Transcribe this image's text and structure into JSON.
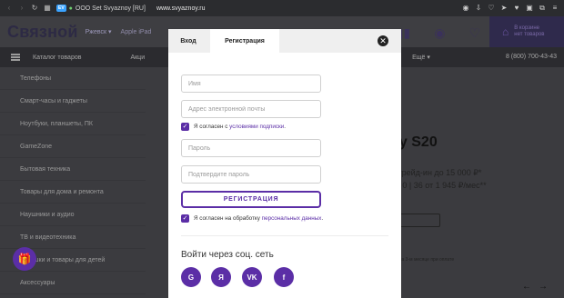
{
  "browser": {
    "ssl_badge": "EV",
    "site_org": "OOO Set Svyaznoy [RU]",
    "url": "www.svyaznoy.ru"
  },
  "site": {
    "logo": "Связной",
    "city": "Ржевск ▾",
    "search_placeholder": "Apple iPad",
    "cart_line1": "В корзине",
    "cart_line2": "нет товаров",
    "nav_catalog": "Каталог товаров",
    "nav_items": [
      "Акци",
      "Ещё ▾"
    ],
    "phone": "8 (800) 700-43-43",
    "sidebar": [
      "Телефоны",
      "Смарт-часы и гаджеты",
      "Ноутбуки, планшеты, ПК",
      "GameZone",
      "Бытовая техника",
      "Товары для дома и ремонта",
      "Наушники и аудио",
      "ТВ и видеотехника",
      "Игрушки и товары для детей",
      "Аксессуары"
    ],
    "promo_title": "ky S20",
    "promo_line1": "о трейд-ин до 15 000 ₽*",
    "promo_line2": "0 | 0 | 36 от 1 945 ₽/мес**",
    "promo_small": "0 ₽ на 3-м месяце при оплате"
  },
  "modal": {
    "tab_login": "Вход",
    "tab_register": "Регистрация",
    "close_symbol": "✕",
    "name_placeholder": "Имя",
    "email_placeholder": "Адрес электронной почты",
    "subscribe_prefix": "Я согласен с ",
    "subscribe_link": "условиями подписки",
    "subscribe_suffix": ".",
    "password_placeholder": "Пароль",
    "password_confirm_placeholder": "Подтвердите пароль",
    "register_button": "РЕГИСТРАЦИЯ",
    "consent_prefix": "Я согласен на обработку ",
    "consent_link": "персональных данных",
    "consent_suffix": ".",
    "social_title": "Войти через соц. сеть",
    "social": {
      "google": "G",
      "yandex": "Я",
      "vk": "VK",
      "facebook": "f"
    }
  },
  "colors": {
    "accent": "#5b2ea6"
  }
}
